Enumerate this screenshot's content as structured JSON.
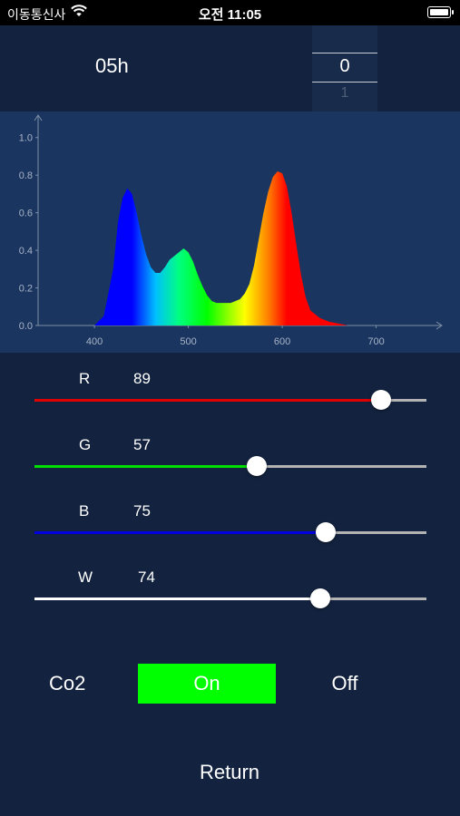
{
  "status_bar": {
    "carrier": "이동통신사",
    "time": "오전 11:05",
    "wifi_icon": "wifi-icon",
    "battery_icon": "battery-icon"
  },
  "header": {
    "hour_label": "05h",
    "picker": {
      "selected": "0",
      "next": "1"
    }
  },
  "chart_data": {
    "type": "area",
    "x_ticks": [
      "400",
      "500",
      "600",
      "700"
    ],
    "y_ticks": [
      "0.0",
      "0.2",
      "0.4",
      "0.6",
      "0.8",
      "1.0"
    ],
    "xlim": [
      340,
      770
    ],
    "ylim": [
      0,
      1.1
    ],
    "x": [
      400,
      410,
      420,
      425,
      430,
      435,
      440,
      445,
      450,
      455,
      460,
      465,
      470,
      475,
      480,
      490,
      495,
      500,
      505,
      510,
      515,
      520,
      525,
      530,
      535,
      540,
      545,
      550,
      555,
      560,
      565,
      570,
      575,
      580,
      585,
      590,
      595,
      600,
      605,
      610,
      615,
      620,
      625,
      630,
      640,
      650,
      660,
      670,
      680
    ],
    "y": [
      0.0,
      0.05,
      0.3,
      0.55,
      0.68,
      0.73,
      0.7,
      0.6,
      0.48,
      0.38,
      0.31,
      0.28,
      0.28,
      0.31,
      0.35,
      0.39,
      0.41,
      0.39,
      0.34,
      0.27,
      0.21,
      0.16,
      0.13,
      0.12,
      0.12,
      0.12,
      0.12,
      0.13,
      0.14,
      0.17,
      0.22,
      0.32,
      0.46,
      0.6,
      0.71,
      0.79,
      0.82,
      0.81,
      0.74,
      0.6,
      0.43,
      0.27,
      0.15,
      0.08,
      0.04,
      0.02,
      0.01,
      0.0,
      0.0
    ],
    "colors": [
      "#0000ff",
      "#00bfff",
      "#00ff80",
      "#ffff00",
      "#ff0000"
    ],
    "background": "#1a3560"
  },
  "sliders": [
    {
      "label": "R",
      "value": "89",
      "fraction": 0.885,
      "color": "#e00000"
    },
    {
      "label": "G",
      "value": "57",
      "fraction": 0.568,
      "color": "#00e000"
    },
    {
      "label": "B",
      "value": "75",
      "fraction": 0.743,
      "color": "#0000e0"
    },
    {
      "label": "W",
      "value": "74",
      "fraction": 0.73,
      "color": "#ffffff"
    }
  ],
  "co2": {
    "label": "Co2",
    "on_label": "On",
    "off_label": "Off",
    "on_color": "#00ff00"
  },
  "return_label": "Return"
}
